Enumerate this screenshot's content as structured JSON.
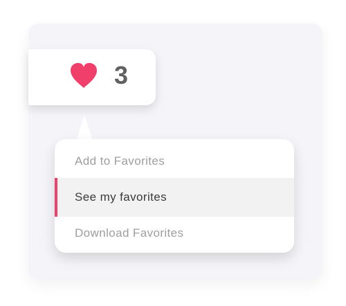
{
  "favorites": {
    "icon": "heart-icon",
    "count": "3",
    "accent_color": "#ef3f6a"
  },
  "menu": {
    "items": [
      {
        "label": "Add to Favorites",
        "state": "normal"
      },
      {
        "label": "See my favorites",
        "state": "selected"
      },
      {
        "label": "Download Favorites",
        "state": "normal"
      }
    ]
  }
}
